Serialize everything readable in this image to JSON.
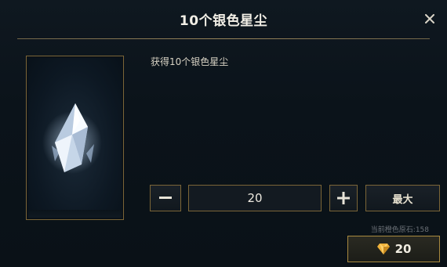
{
  "dialog": {
    "title": "10个银色星尘",
    "close_icon": "close-icon"
  },
  "item": {
    "icon": "crystal-gem-icon",
    "description": "获得10个银色星尘"
  },
  "quantity": {
    "minus_icon": "minus-icon",
    "value": "20",
    "plus_icon": "plus-icon",
    "max_label": "最大"
  },
  "currency": {
    "balance_text": "当前橙色原石:158",
    "price": "20",
    "price_icon": "orange-essence-icon"
  },
  "colors": {
    "accent_gold": "#7b6537",
    "background": "#0b131a",
    "text": "#e6e2d6"
  }
}
